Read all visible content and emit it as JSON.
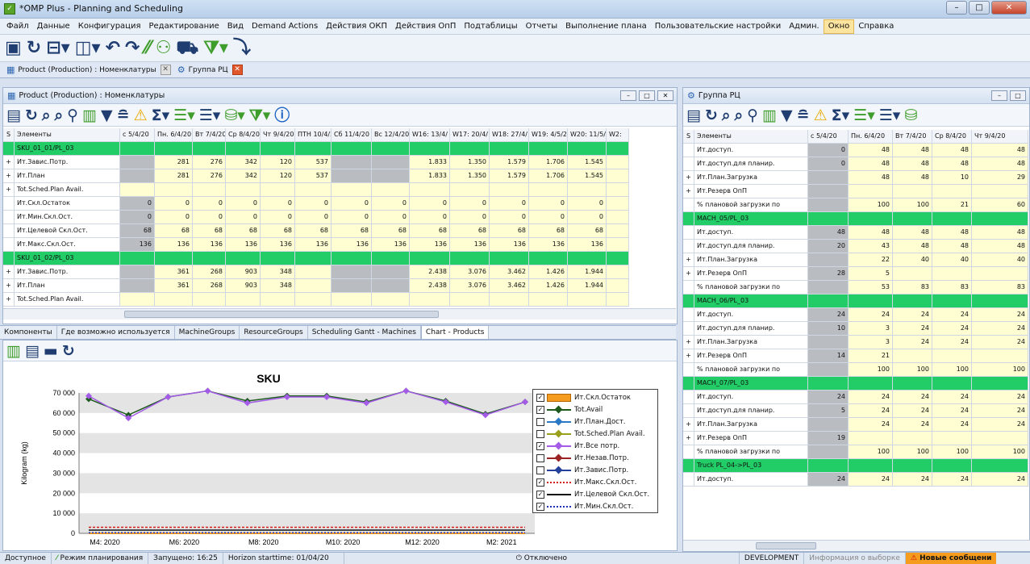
{
  "window": {
    "title": "*OMP Plus - Planning and Scheduling"
  },
  "menu": [
    "Файл",
    "Данные",
    "Конфигурация",
    "Редактирование",
    "Вид",
    "Demand Actions",
    "Действия ОКП",
    "Действия ОпП",
    "Подтаблицы",
    "Отчеты",
    "Выполнение плана",
    "Пользовательские настройки",
    "Админ.",
    "Окно",
    "Справка"
  ],
  "doc_tabs": [
    {
      "label": "Product (Production) : Номенклатуры"
    },
    {
      "label": "Группа РЦ"
    }
  ],
  "left_pane": {
    "title": "Product (Production) : Номенклатуры",
    "grid": {
      "headers": [
        "S",
        "Элементы",
        "с 5/4/20",
        "Пн. 6/4/20",
        "Вт 7/4/20",
        "Ср 8/4/20",
        "Чт 9/4/20",
        "ПТН 10/4/2",
        "Сб 11/4/20",
        "Вс 12/4/20",
        "W16: 13/4/",
        "W17: 20/4/",
        "W18: 27/4/",
        "W19: 4/5/2",
        "W20: 11/5/",
        "W2:"
      ],
      "rows": [
        {
          "kind": "group",
          "s": "",
          "label": "SKU_01_01/PL_03",
          "cells": [
            "",
            "",
            "",
            "",
            "",
            "",
            "",
            "",
            "",
            "",
            "",
            "",
            "",
            ""
          ]
        },
        {
          "kind": "data",
          "s": "+",
          "label": "Ит.Завис.Потр.",
          "cells": [
            "",
            "281",
            "276",
            "342",
            "120",
            "537",
            "",
            "",
            "1.833",
            "1.350",
            "1.579",
            "1.706",
            "1.545",
            ""
          ]
        },
        {
          "kind": "data",
          "s": "+",
          "label": "Ит.План",
          "cells": [
            "",
            "281",
            "276",
            "342",
            "120",
            "537",
            "",
            "",
            "1.833",
            "1.350",
            "1.579",
            "1.706",
            "1.545",
            ""
          ]
        },
        {
          "kind": "data",
          "s": "+",
          "label": "Tot.Sched.Plan Avail.",
          "cells": [
            "",
            "",
            "",
            "",
            "",
            "",
            "",
            "",
            "",
            "",
            "",
            "",
            "",
            ""
          ]
        },
        {
          "kind": "data",
          "s": "",
          "label": "Ит.Скл.Остаток",
          "cells": [
            "0",
            "0",
            "0",
            "0",
            "0",
            "0",
            "0",
            "0",
            "0",
            "0",
            "0",
            "0",
            "0",
            ""
          ]
        },
        {
          "kind": "data",
          "s": "",
          "label": "Ит.Мин.Скл.Ост.",
          "cells": [
            "0",
            "0",
            "0",
            "0",
            "0",
            "0",
            "0",
            "0",
            "0",
            "0",
            "0",
            "0",
            "0",
            ""
          ]
        },
        {
          "kind": "data",
          "s": "",
          "label": "Ит.Целевой Скл.Ост.",
          "cells": [
            "68",
            "68",
            "68",
            "68",
            "68",
            "68",
            "68",
            "68",
            "68",
            "68",
            "68",
            "68",
            "68",
            ""
          ]
        },
        {
          "kind": "data",
          "s": "",
          "label": "Ит.Макс.Скл.Ост.",
          "cells": [
            "136",
            "136",
            "136",
            "136",
            "136",
            "136",
            "136",
            "136",
            "136",
            "136",
            "136",
            "136",
            "136",
            ""
          ]
        },
        {
          "kind": "group",
          "s": "",
          "label": "SKU_01_02/PL_03",
          "cells": [
            "",
            "",
            "",
            "",
            "",
            "",
            "",
            "",
            "",
            "",
            "",
            "",
            "",
            ""
          ]
        },
        {
          "kind": "data",
          "s": "+",
          "label": "Ит.Завис.Потр.",
          "cells": [
            "",
            "361",
            "268",
            "903",
            "348",
            "",
            "",
            "",
            "2.438",
            "3.076",
            "3.462",
            "1.426",
            "1.944",
            ""
          ]
        },
        {
          "kind": "data",
          "s": "+",
          "label": "Ит.План",
          "cells": [
            "",
            "361",
            "268",
            "903",
            "348",
            "",
            "",
            "",
            "2.438",
            "3.076",
            "3.462",
            "1.426",
            "1.944",
            ""
          ]
        },
        {
          "kind": "data",
          "s": "+",
          "label": "Tot.Sched.Plan Avail.",
          "cells": [
            "",
            "",
            "",
            "",
            "",
            "",
            "",
            "",
            "",
            "",
            "",
            "",
            "",
            ""
          ]
        }
      ]
    }
  },
  "bottom_tabs": [
    "Компоненты",
    "Где возможно используется",
    "MachineGroups",
    "ResourceGroups",
    "Scheduling Gantt - Machines",
    "Chart - Products"
  ],
  "chart_data": {
    "type": "line",
    "title": "SKU",
    "ylabel": "Kilogram (kg)",
    "xlabel": "",
    "ylim": [
      0,
      70000
    ],
    "yticks": [
      "70 000",
      "60 000",
      "50 000",
      "40 000",
      "30 000",
      "20 000",
      "10 000",
      "0"
    ],
    "xticks": [
      "M4: 2020",
      "M6: 2020",
      "M8: 2020",
      "M10: 2020",
      "M12: 2020",
      "M2: 2021"
    ],
    "x": [
      1,
      2,
      3,
      4,
      5,
      6,
      7,
      8,
      9,
      10,
      11,
      12
    ],
    "series": [
      {
        "name": "Ит.Скл.Остаток",
        "checked": true,
        "color": "#f59b1e",
        "values": [
          0,
          0,
          0,
          0,
          0,
          0,
          0,
          0,
          0,
          0,
          0,
          0
        ]
      },
      {
        "name": "Tot.Avail",
        "checked": true,
        "color": "#1d5a1d",
        "values": [
          67000,
          59000,
          68000,
          71000,
          66000,
          68500,
          68500,
          65500,
          71000,
          66000,
          59500,
          65500
        ]
      },
      {
        "name": "Ит.План.Дост.",
        "checked": false,
        "color": "#2b78c4",
        "values": []
      },
      {
        "name": "Tot.Sched.Plan Avail.",
        "checked": false,
        "color": "#9aa01c",
        "values": []
      },
      {
        "name": "Ит.Все потр.",
        "checked": true,
        "color": "#a45be8",
        "values": [
          68500,
          57500,
          68000,
          71000,
          65000,
          68000,
          68000,
          65000,
          71000,
          65500,
          59000,
          65500
        ]
      },
      {
        "name": "Ит.Незав.Потр.",
        "checked": false,
        "color": "#9b2222",
        "values": []
      },
      {
        "name": "Ит.Завис.Потр.",
        "checked": false,
        "color": "#23409a",
        "values": []
      },
      {
        "name": "Ит.Макс.Скл.Ост.",
        "checked": true,
        "color": "#d21c1c",
        "values": [
          3000,
          3000,
          3000,
          3000,
          3000,
          3000,
          3000,
          3000,
          3000,
          3000,
          3000,
          3000
        ]
      },
      {
        "name": "Ит.Целевой Скл.Ост.",
        "checked": true,
        "color": "#111111",
        "values": [
          1600,
          1600,
          1600,
          1600,
          1600,
          1600,
          1600,
          1600,
          1600,
          1600,
          1600,
          1600
        ]
      },
      {
        "name": "Ит.Мин.Скл.Ост.",
        "checked": true,
        "color": "#2230b8",
        "values": [
          300,
          300,
          300,
          300,
          300,
          300,
          300,
          300,
          300,
          300,
          300,
          300
        ]
      }
    ]
  },
  "right_pane": {
    "title": "Группа РЦ",
    "grid": {
      "headers": [
        "S",
        "Элементы",
        "с 5/4/20",
        "Пн. 6/4/20",
        "Вт 7/4/20",
        "Ср 8/4/20",
        "Чт 9/4/20"
      ],
      "rows": [
        {
          "kind": "data",
          "s": "",
          "label": "Ит.доступ.",
          "cells": [
            "0",
            "48",
            "48",
            "48",
            "48"
          ]
        },
        {
          "kind": "data",
          "s": "",
          "label": "Ит.доступ.для планир.",
          "cells": [
            "0",
            "48",
            "48",
            "48",
            "48"
          ]
        },
        {
          "kind": "data",
          "s": "+",
          "label": "Ит.План.Загрузка",
          "cells": [
            "",
            "48",
            "48",
            "10",
            "29"
          ]
        },
        {
          "kind": "data",
          "s": "+",
          "label": "Ит.Резерв ОпП",
          "cells": [
            "",
            "",
            "",
            "",
            ""
          ]
        },
        {
          "kind": "data",
          "s": "",
          "label": "% плановой загрузки по",
          "cells": [
            "",
            "100",
            "100",
            "21",
            "60"
          ]
        },
        {
          "kind": "group",
          "s": "",
          "label": "MACH_05/PL_03",
          "cells": [
            "",
            "",
            "",
            "",
            ""
          ]
        },
        {
          "kind": "data",
          "s": "",
          "label": "Ит.доступ.",
          "cells": [
            "48",
            "48",
            "48",
            "48",
            "48"
          ]
        },
        {
          "kind": "data",
          "s": "",
          "label": "Ит.доступ.для планир.",
          "cells": [
            "20",
            "43",
            "48",
            "48",
            "48"
          ]
        },
        {
          "kind": "data",
          "s": "+",
          "label": "Ит.План.Загрузка",
          "cells": [
            "",
            "22",
            "40",
            "40",
            "40"
          ]
        },
        {
          "kind": "data",
          "s": "+",
          "label": "Ит.Резерв ОпП",
          "cells": [
            "28",
            "5",
            "",
            "",
            ""
          ]
        },
        {
          "kind": "data",
          "s": "",
          "label": "% плановой загрузки по",
          "cells": [
            "",
            "53",
            "83",
            "83",
            "83"
          ]
        },
        {
          "kind": "group",
          "s": "",
          "label": "MACH_06/PL_03",
          "cells": [
            "",
            "",
            "",
            "",
            ""
          ]
        },
        {
          "kind": "data",
          "s": "",
          "label": "Ит.доступ.",
          "cells": [
            "24",
            "24",
            "24",
            "24",
            "24"
          ]
        },
        {
          "kind": "data",
          "s": "",
          "label": "Ит.доступ.для планир.",
          "cells": [
            "10",
            "3",
            "24",
            "24",
            "24"
          ]
        },
        {
          "kind": "data",
          "s": "+",
          "label": "Ит.План.Загрузка",
          "cells": [
            "",
            "3",
            "24",
            "24",
            "24"
          ]
        },
        {
          "kind": "data",
          "s": "+",
          "label": "Ит.Резерв ОпП",
          "cells": [
            "14",
            "21",
            "",
            "",
            ""
          ]
        },
        {
          "kind": "data",
          "s": "",
          "label": "% плановой загрузки по",
          "cells": [
            "",
            "100",
            "100",
            "100",
            "100"
          ]
        },
        {
          "kind": "group",
          "s": "",
          "label": "MACH_07/PL_03",
          "cells": [
            "",
            "",
            "",
            "",
            ""
          ]
        },
        {
          "kind": "data",
          "s": "",
          "label": "Ит.доступ.",
          "cells": [
            "24",
            "24",
            "24",
            "24",
            "24"
          ]
        },
        {
          "kind": "data",
          "s": "",
          "label": "Ит.доступ.для планир.",
          "cells": [
            "5",
            "24",
            "24",
            "24",
            "24"
          ]
        },
        {
          "kind": "data",
          "s": "+",
          "label": "Ит.План.Загрузка",
          "cells": [
            "",
            "24",
            "24",
            "24",
            "24"
          ]
        },
        {
          "kind": "data",
          "s": "+",
          "label": "Ит.Резерв ОпП",
          "cells": [
            "19",
            "",
            "",
            "",
            ""
          ]
        },
        {
          "kind": "data",
          "s": "",
          "label": "% плановой загрузки по",
          "cells": [
            "",
            "100",
            "100",
            "100",
            "100"
          ]
        },
        {
          "kind": "group",
          "s": "",
          "label": "Truck PL_04->PL_03",
          "cells": [
            "",
            "",
            "",
            "",
            ""
          ]
        },
        {
          "kind": "data",
          "s": "",
          "label": "Ит.доступ.",
          "cells": [
            "24",
            "24",
            "24",
            "24",
            "24"
          ]
        }
      ]
    }
  },
  "status": {
    "avail": "Доступное",
    "mode": "Режим планирования",
    "started": "Запущено: 16:25",
    "horizon": "Horizon starttime: 01/04/20",
    "off": "Отключено",
    "env": "DEVELOPMENT",
    "info": "Информация о выборке",
    "msgs": "Новые сообщени"
  }
}
